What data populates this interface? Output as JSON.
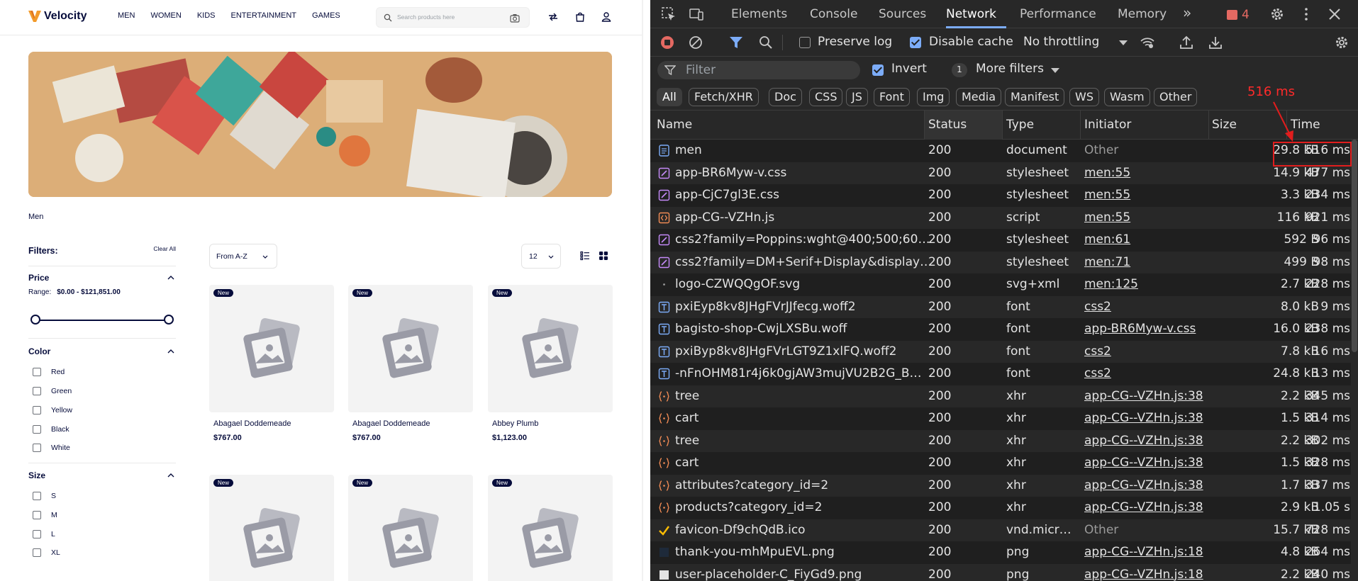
{
  "shop": {
    "brand": "Velocity",
    "nav": [
      "MEN",
      "WOMEN",
      "KIDS",
      "ENTERTAINMENT",
      "GAMES"
    ],
    "search_placeholder": "Search products here",
    "breadcrumb": "Men",
    "filters_title": "Filters:",
    "clear_all": "Clear All",
    "price": {
      "title": "Price",
      "range_label": "Range:",
      "range_value": "$0.00 - $121,851.00"
    },
    "color": {
      "title": "Color",
      "options": [
        "Red",
        "Green",
        "Yellow",
        "Black",
        "White"
      ]
    },
    "size": {
      "title": "Size",
      "options": [
        "S",
        "M",
        "L",
        "XL"
      ]
    },
    "sort_value": "From A-Z",
    "limit_value": "12",
    "badge": "New",
    "products": [
      {
        "name": "Abagael Doddemeade",
        "price": "$767.00"
      },
      {
        "name": "Abagael Doddemeade",
        "price": "$767.00"
      },
      {
        "name": "Abbey Plumb",
        "price": "$1,123.00"
      },
      {
        "name": "",
        "price": ""
      },
      {
        "name": "",
        "price": ""
      },
      {
        "name": "",
        "price": ""
      }
    ]
  },
  "devtools": {
    "tabs": [
      "Elements",
      "Console",
      "Sources",
      "Network",
      "Performance",
      "Memory"
    ],
    "active_tab": "Network",
    "issues_count": "4",
    "preserve_log": "Preserve log",
    "disable_cache": "Disable cache",
    "throttling": "No throttling",
    "filter_placeholder": "Filter",
    "invert": "Invert",
    "more_filters_count": "1",
    "more_filters": "More filters",
    "type_filters": [
      "All",
      "Fetch/XHR",
      "Doc",
      "CSS",
      "JS",
      "Font",
      "Img",
      "Media",
      "Manifest",
      "WS",
      "Wasm",
      "Other"
    ],
    "columns": [
      "Name",
      "Status",
      "Type",
      "Initiator",
      "Size",
      "Time"
    ],
    "annotation": "516 ms",
    "colors": {
      "accent": "#7cacf8",
      "annotation": "#e11d1d",
      "record": "#e46962"
    },
    "requests": [
      {
        "icon": "doc-icon",
        "name": "men",
        "status": "200",
        "type": "document",
        "initiator": "Other",
        "size": "29.8 kB",
        "time": "516 ms"
      },
      {
        "icon": "css-icon",
        "name": "app-BR6Myw-v.css",
        "status": "200",
        "type": "stylesheet",
        "initiator": "men:55",
        "size": "14.9 kB",
        "time": "477 ms"
      },
      {
        "icon": "css-icon",
        "name": "app-CjC7gl3E.css",
        "status": "200",
        "type": "stylesheet",
        "initiator": "men:55",
        "size": "3.3 kB",
        "time": "234 ms"
      },
      {
        "icon": "script-icon",
        "name": "app-CG--VZHn.js",
        "status": "200",
        "type": "script",
        "initiator": "men:55",
        "size": "116 kB",
        "time": "921 ms"
      },
      {
        "icon": "css-icon",
        "name": "css2?family=Poppins:wght@400;500;60…",
        "status": "200",
        "type": "stylesheet",
        "initiator": "men:61",
        "size": "592 B",
        "time": "96 ms"
      },
      {
        "icon": "css-icon",
        "name": "css2?family=DM+Serif+Display&display…",
        "status": "200",
        "type": "stylesheet",
        "initiator": "men:71",
        "size": "499 B",
        "time": "98 ms"
      },
      {
        "icon": "img-icon",
        "name": "logo-CZWQQgOF.svg",
        "status": "200",
        "type": "svg+xml",
        "initiator": "men:125",
        "size": "2.7 kB",
        "time": "228 ms"
      },
      {
        "icon": "font-icon",
        "name": "pxiEyp8kv8JHgFVrJJfecg.woff2",
        "status": "200",
        "type": "font",
        "initiator": "css2",
        "size": "8.0 kB",
        "time": "9 ms"
      },
      {
        "icon": "font-icon",
        "name": "bagisto-shop-CwjLXSBu.woff",
        "status": "200",
        "type": "font",
        "initiator": "app-BR6Myw-v.css",
        "size": "16.0 kB",
        "time": "238 ms"
      },
      {
        "icon": "font-icon",
        "name": "pxiByp8kv8JHgFVrLGT9Z1xlFQ.woff2",
        "status": "200",
        "type": "font",
        "initiator": "css2",
        "size": "7.8 kB",
        "time": "16 ms"
      },
      {
        "icon": "font-icon",
        "name": "-nFnOHM81r4j6k0gjAW3mujVU2B2G_B…",
        "status": "200",
        "type": "font",
        "initiator": "css2",
        "size": "24.8 kB",
        "time": "13 ms"
      },
      {
        "icon": "xhr-icon",
        "name": "tree",
        "status": "200",
        "type": "xhr",
        "initiator": "app-CG--VZHn.js:38",
        "size": "2.2 kB",
        "time": "345 ms"
      },
      {
        "icon": "xhr-icon",
        "name": "cart",
        "status": "200",
        "type": "xhr",
        "initiator": "app-CG--VZHn.js:38",
        "size": "1.5 kB",
        "time": "314 ms"
      },
      {
        "icon": "xhr-icon",
        "name": "tree",
        "status": "200",
        "type": "xhr",
        "initiator": "app-CG--VZHn.js:38",
        "size": "2.2 kB",
        "time": "302 ms"
      },
      {
        "icon": "xhr-icon",
        "name": "cart",
        "status": "200",
        "type": "xhr",
        "initiator": "app-CG--VZHn.js:38",
        "size": "1.5 kB",
        "time": "328 ms"
      },
      {
        "icon": "xhr-icon",
        "name": "attributes?category_id=2",
        "status": "200",
        "type": "xhr",
        "initiator": "app-CG--VZHn.js:38",
        "size": "1.7 kB",
        "time": "337 ms"
      },
      {
        "icon": "xhr-icon",
        "name": "products?category_id=2",
        "status": "200",
        "type": "xhr",
        "initiator": "app-CG--VZHn.js:38",
        "size": "2.9 kB",
        "time": "1.05 s"
      },
      {
        "icon": "favicon-icon",
        "name": "favicon-Df9chQdB.ico",
        "status": "200",
        "type": "vnd.micr…",
        "initiator": "Other",
        "size": "15.7 kB",
        "time": "728 ms"
      },
      {
        "icon": "png-icon",
        "name": "thank-you-mhMpuEVL.png",
        "status": "200",
        "type": "png",
        "initiator": "app-CG--VZHn.js:18",
        "size": "4.8 kB",
        "time": "264 ms"
      },
      {
        "icon": "png-icon",
        "name": "user-placeholder-C_FiyGd9.png",
        "status": "200",
        "type": "png",
        "initiator": "app-CG--VZHn.js:18",
        "size": "2.2 kB",
        "time": "240 ms"
      }
    ]
  }
}
